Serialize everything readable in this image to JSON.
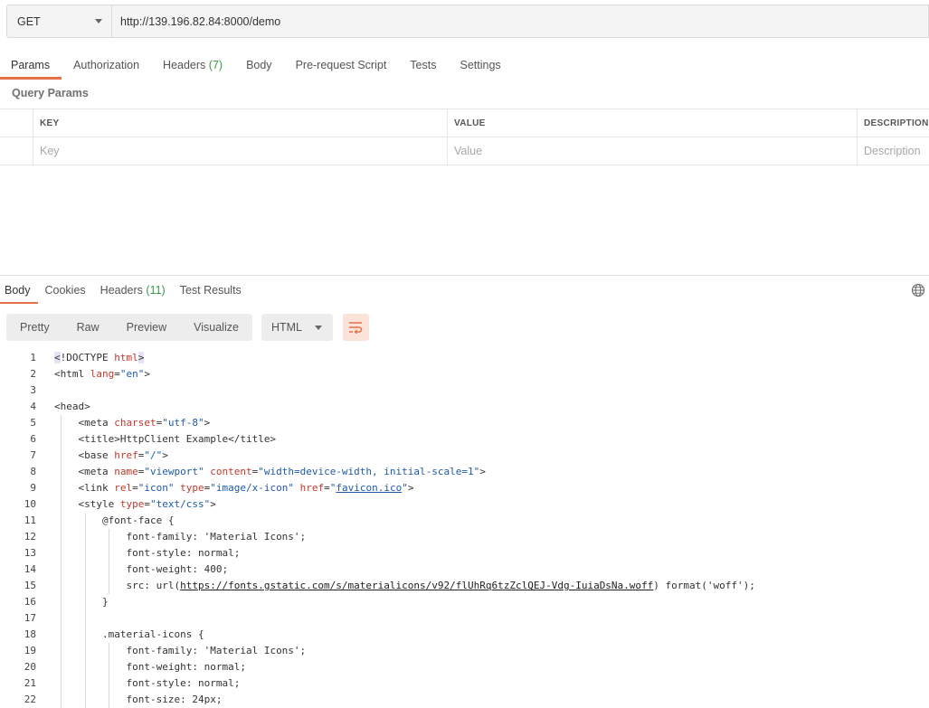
{
  "request": {
    "method": "GET",
    "url": "http://139.196.82.84:8000/demo"
  },
  "request_tabs": [
    {
      "label": "Params",
      "count": "",
      "active": true
    },
    {
      "label": "Authorization",
      "count": ""
    },
    {
      "label": "Headers",
      "count": "(7)"
    },
    {
      "label": "Body",
      "count": ""
    },
    {
      "label": "Pre-request Script",
      "count": ""
    },
    {
      "label": "Tests",
      "count": ""
    },
    {
      "label": "Settings",
      "count": ""
    }
  ],
  "query_params": {
    "title": "Query Params",
    "headers": {
      "key": "KEY",
      "value": "VALUE",
      "description": "DESCRIPTION"
    },
    "placeholders": {
      "key": "Key",
      "value": "Value",
      "description": "Description"
    }
  },
  "response_tabs": [
    {
      "label": "Body",
      "count": "",
      "active": true
    },
    {
      "label": "Cookies",
      "count": ""
    },
    {
      "label": "Headers",
      "count": "(11)"
    },
    {
      "label": "Test Results",
      "count": ""
    }
  ],
  "body_toolbar": {
    "views": [
      "Pretty",
      "Raw",
      "Preview",
      "Visualize"
    ],
    "format": "HTML"
  },
  "icons": {
    "globe": "globe-icon",
    "wrap": "wrap-lines-icon",
    "dropdown": "chevron-down-icon"
  },
  "colors": {
    "accent": "#e4704a",
    "count": "#3a9a46",
    "attr": "#c0392b",
    "value": "#1e5aa8"
  },
  "code_lines": [
    {
      "n": "1",
      "indent": 0,
      "tokens": [
        [
          "brk",
          "<"
        ],
        [
          "tg",
          "!DOCTYPE "
        ],
        [
          "at",
          "html"
        ],
        [
          "brk",
          ">"
        ]
      ]
    },
    {
      "n": "2",
      "indent": 0,
      "tokens": [
        [
          "tg",
          "<html "
        ],
        [
          "at",
          "lang"
        ],
        [
          "tg",
          "="
        ],
        [
          "va",
          "\"en\""
        ],
        [
          "tg",
          ">"
        ]
      ]
    },
    {
      "n": "3",
      "indent": 0,
      "tokens": []
    },
    {
      "n": "4",
      "indent": 0,
      "tokens": [
        [
          "tg",
          "<head>"
        ]
      ]
    },
    {
      "n": "5",
      "indent": 1,
      "tokens": [
        [
          "tg",
          "<meta "
        ],
        [
          "at",
          "charset"
        ],
        [
          "tg",
          "="
        ],
        [
          "va",
          "\"utf-8\""
        ],
        [
          "tg",
          ">"
        ]
      ]
    },
    {
      "n": "6",
      "indent": 1,
      "tokens": [
        [
          "tg",
          "<title>"
        ],
        [
          "tg",
          "HttpClient Example"
        ],
        [
          "tg",
          "</title>"
        ]
      ]
    },
    {
      "n": "7",
      "indent": 1,
      "tokens": [
        [
          "tg",
          "<base "
        ],
        [
          "at",
          "href"
        ],
        [
          "tg",
          "="
        ],
        [
          "va",
          "\"/\""
        ],
        [
          "tg",
          ">"
        ]
      ]
    },
    {
      "n": "8",
      "indent": 1,
      "tokens": [
        [
          "tg",
          "<meta "
        ],
        [
          "at",
          "name"
        ],
        [
          "tg",
          "="
        ],
        [
          "va",
          "\"viewport\""
        ],
        [
          "tg",
          " "
        ],
        [
          "at",
          "content"
        ],
        [
          "tg",
          "="
        ],
        [
          "va",
          "\"width=device-width, initial-scale=1\""
        ],
        [
          "tg",
          ">"
        ]
      ]
    },
    {
      "n": "9",
      "indent": 1,
      "tokens": [
        [
          "tg",
          "<link "
        ],
        [
          "at",
          "rel"
        ],
        [
          "tg",
          "="
        ],
        [
          "va",
          "\"icon\""
        ],
        [
          "tg",
          " "
        ],
        [
          "at",
          "type"
        ],
        [
          "tg",
          "="
        ],
        [
          "va",
          "\"image/x-icon\""
        ],
        [
          "tg",
          " "
        ],
        [
          "at",
          "href"
        ],
        [
          "tg",
          "="
        ],
        [
          "va",
          "\""
        ],
        [
          "lk",
          "favicon.ico"
        ],
        [
          "va",
          "\""
        ],
        [
          "tg",
          ">"
        ]
      ]
    },
    {
      "n": "10",
      "indent": 1,
      "tokens": [
        [
          "tg",
          "<style "
        ],
        [
          "at",
          "type"
        ],
        [
          "tg",
          "="
        ],
        [
          "va",
          "\"text/css\""
        ],
        [
          "tg",
          ">"
        ]
      ]
    },
    {
      "n": "11",
      "indent": 2,
      "tokens": [
        [
          "tg",
          "@font-face {"
        ]
      ]
    },
    {
      "n": "12",
      "indent": 3,
      "tokens": [
        [
          "tg",
          "font-family: 'Material Icons';"
        ]
      ]
    },
    {
      "n": "13",
      "indent": 3,
      "tokens": [
        [
          "tg",
          "font-style: normal;"
        ]
      ]
    },
    {
      "n": "14",
      "indent": 3,
      "tokens": [
        [
          "tg",
          "font-weight: 400;"
        ]
      ]
    },
    {
      "n": "15",
      "indent": 3,
      "tokens": [
        [
          "tg",
          "src: url("
        ],
        [
          "lkb",
          "https://fonts.gstatic.com/s/materialicons/v92/flUhRq6tzZclQEJ-Vdg-IuiaDsNa.woff"
        ],
        [
          "tg",
          ") format('woff');"
        ]
      ]
    },
    {
      "n": "16",
      "indent": 2,
      "tokens": [
        [
          "tg",
          "}"
        ]
      ]
    },
    {
      "n": "17",
      "indent": 2,
      "tokens": []
    },
    {
      "n": "18",
      "indent": 2,
      "tokens": [
        [
          "tg",
          ".material-icons {"
        ]
      ]
    },
    {
      "n": "19",
      "indent": 3,
      "tokens": [
        [
          "tg",
          "font-family: 'Material Icons';"
        ]
      ]
    },
    {
      "n": "20",
      "indent": 3,
      "tokens": [
        [
          "tg",
          "font-weight: normal;"
        ]
      ]
    },
    {
      "n": "21",
      "indent": 3,
      "tokens": [
        [
          "tg",
          "font-style: normal;"
        ]
      ]
    },
    {
      "n": "22",
      "indent": 3,
      "tokens": [
        [
          "tg",
          "font-size: 24px;"
        ]
      ]
    }
  ]
}
